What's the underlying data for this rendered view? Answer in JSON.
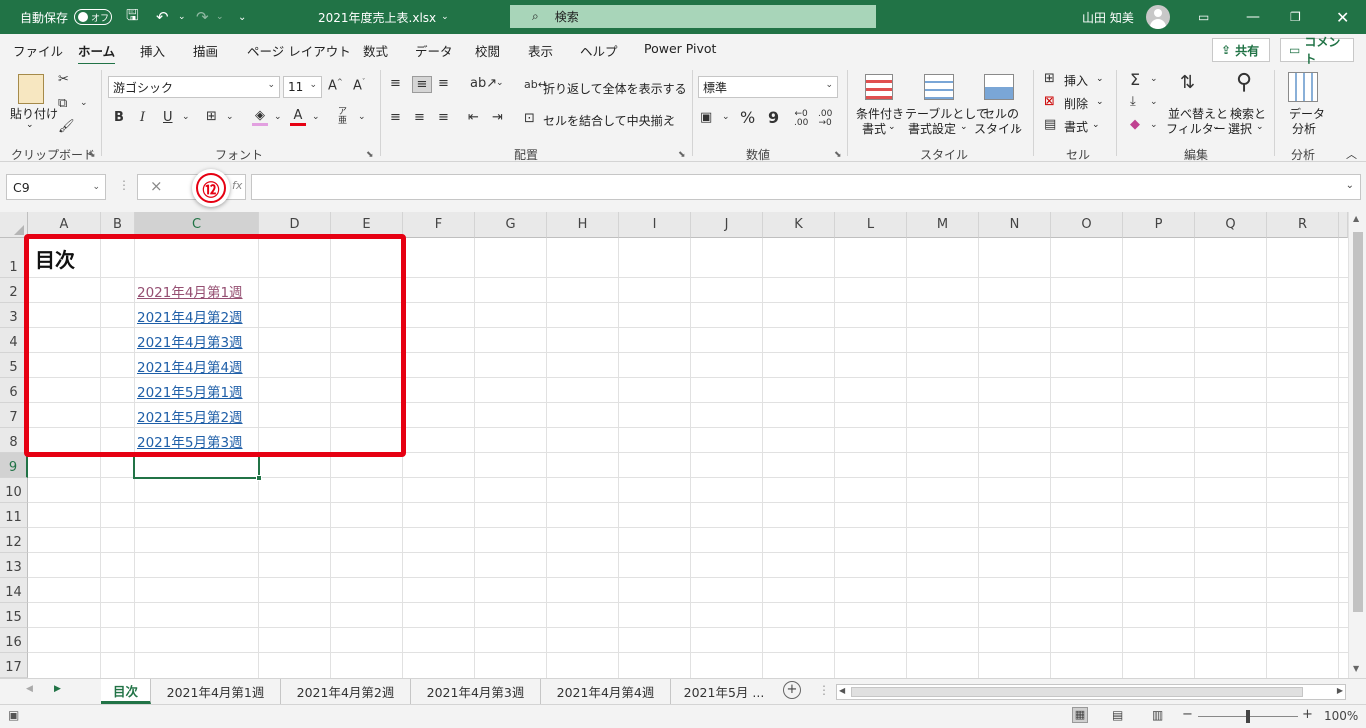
{
  "titlebar": {
    "autosave_label": "自動保存",
    "autosave_state": "オフ",
    "filename": "2021年度売上表.xlsx",
    "filename_caret": "⌄",
    "search_placeholder": "検索",
    "user_name": "山田 知美"
  },
  "menu": {
    "tabs": [
      "ファイル",
      "ホーム",
      "挿入",
      "描画",
      "ページ レイアウト",
      "数式",
      "データ",
      "校閲",
      "表示",
      "ヘルプ",
      "Power Pivot"
    ],
    "share_label": "共有",
    "comment_label": "コメント"
  },
  "ribbon": {
    "clipboard": {
      "paste_label": "貼り付け",
      "group_label": "クリップボード"
    },
    "font": {
      "font_name": "游ゴシック",
      "font_size": "11",
      "bold": "B",
      "italic": "I",
      "underline": "U",
      "group_label": "フォント"
    },
    "alignment": {
      "wrap_label": "折り返して全体を表示する",
      "merge_label": "セルを結合して中央揃え",
      "group_label": "配置"
    },
    "number": {
      "format": "標準",
      "percent": "%",
      "comma": "9",
      "group_label": "数値"
    },
    "styles": {
      "cond_format_l1": "条件付き",
      "cond_format_l2": "書式",
      "table_l1": "テーブルとして",
      "table_l2": "書式設定",
      "cell_style_l1": "セルの",
      "cell_style_l2": "スタイル",
      "group_label": "スタイル"
    },
    "cells": {
      "insert": "挿入",
      "delete": "削除",
      "format": "書式",
      "group_label": "セル"
    },
    "editing": {
      "sort_l1": "並べ替えと",
      "sort_l2": "フィルター",
      "find_l1": "検索と",
      "find_l2": "選択",
      "group_label": "編集"
    },
    "analysis": {
      "data_l1": "データ",
      "data_l2": "分析",
      "group_label": "分析"
    }
  },
  "formula_bar": {
    "name_box": "C9",
    "cancel": "×",
    "callout_number": "⑫"
  },
  "grid": {
    "columns": [
      "A",
      "B",
      "C",
      "D",
      "E",
      "F",
      "G",
      "H",
      "I",
      "J",
      "K",
      "L",
      "M",
      "N",
      "O",
      "P",
      "Q",
      "R"
    ],
    "rows": [
      "1",
      "2",
      "3",
      "4",
      "5",
      "6",
      "7",
      "8",
      "9",
      "10",
      "11",
      "12",
      "13",
      "14",
      "15",
      "16",
      "17"
    ],
    "a1_title": "目次",
    "links": [
      "2021年4月第1週",
      "2021年4月第2週",
      "2021年4月第3週",
      "2021年4月第4週",
      "2021年5月第1週",
      "2021年5月第2週",
      "2021年5月第3週"
    ]
  },
  "sheet_tabs": [
    "目次",
    "2021年4月第1週",
    "2021年4月第2週",
    "2021年4月第3週",
    "2021年4月第4週",
    "2021年5月 ..."
  ],
  "status": {
    "zoom": "100%",
    "zoom_minus": "−",
    "zoom_plus": "+"
  },
  "colors": {
    "excel_green": "#217346",
    "callout_red": "#e60012",
    "link_blue": "#1f5fa8",
    "link_visited": "#954f72"
  }
}
